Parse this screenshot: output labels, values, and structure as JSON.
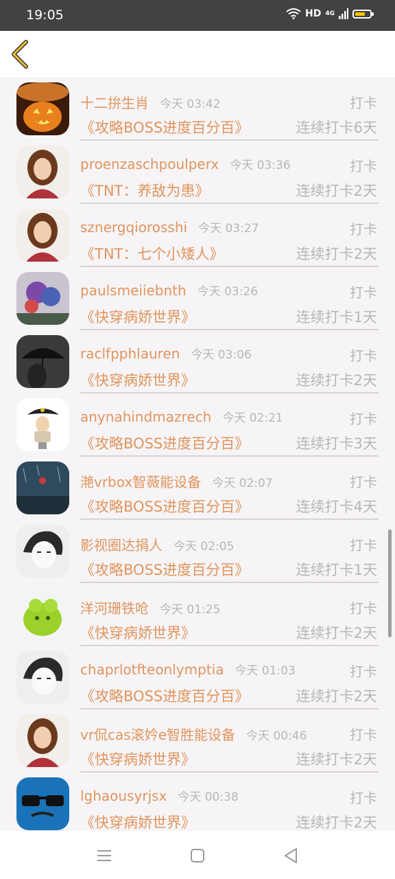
{
  "status": {
    "time": "19:05",
    "network": "HD",
    "signal": "4G"
  },
  "rows": [
    {
      "name": "十二拚生肖",
      "time": "今天 03:42",
      "action": "打卡",
      "book": "《攻略BOSS进度百分百》",
      "streak": "连续打卡6天",
      "avatar": "pumpkin-avatar"
    },
    {
      "name": "proenzaschpoulperx",
      "time": "今天 03:36",
      "action": "打卡",
      "book": "《TNT：养敌为患》",
      "streak": "连续打卡2天",
      "avatar": "girl-avatar"
    },
    {
      "name": "sznergqiorosshi",
      "time": "今天 03:27",
      "action": "打卡",
      "book": "《TNT：七个小矮人》",
      "streak": "连续打卡2天",
      "avatar": "girl-avatar"
    },
    {
      "name": "paulsmeiiebnth",
      "time": "今天 03:26",
      "action": "打卡",
      "book": "《快穿病娇世界》",
      "streak": "连续打卡1天",
      "avatar": "balloons-avatar"
    },
    {
      "name": "raclfpphlauren",
      "time": "今天 03:06",
      "action": "打卡",
      "book": "《快穿病娇世界》",
      "streak": "连续打卡2天",
      "avatar": "umbrella-avatar"
    },
    {
      "name": "anynahindmazrech",
      "time": "今天 02:21",
      "action": "打卡",
      "book": "《攻略BOSS进度百分百》",
      "streak": "连续打卡3天",
      "avatar": "pirate-avatar"
    },
    {
      "name": "滟vrbox智薇能设备",
      "time": "今天 02:07",
      "action": "打卡",
      "book": "《攻略BOSS进度百分百》",
      "streak": "连续打卡4天",
      "avatar": "rain-avatar"
    },
    {
      "name": "影视圈达捐人",
      "time": "今天 02:05",
      "action": "打卡",
      "book": "《攻略BOSS进度百分百》",
      "streak": "连续打卡1天",
      "avatar": "anime-avatar"
    },
    {
      "name": "洋河珊铁呛",
      "time": "今天 01:25",
      "action": "打卡",
      "book": "《快穿病娇世界》",
      "streak": "连续打卡2天",
      "avatar": "monster-avatar"
    },
    {
      "name": "chaprlotfteonlymptia",
      "time": "今天 01:03",
      "action": "打卡",
      "book": "《攻略BOSS进度百分百》",
      "streak": "连续打卡2天",
      "avatar": "anime-avatar"
    },
    {
      "name": "vr侃cas滚妗e智胜能设备",
      "time": "今天 00:46",
      "action": "打卡",
      "book": "《快穿病娇世界》",
      "streak": "连续打卡2天",
      "avatar": "girl-avatar"
    },
    {
      "name": "lghaousyrjsx",
      "time": "今天 00:38",
      "action": "打卡",
      "book": "《快穿病娇世界》",
      "streak": "连续打卡2天",
      "avatar": "sunglasses-avatar"
    }
  ],
  "colors": {
    "accent": "#e0955d",
    "muted": "#b7b7b7"
  }
}
